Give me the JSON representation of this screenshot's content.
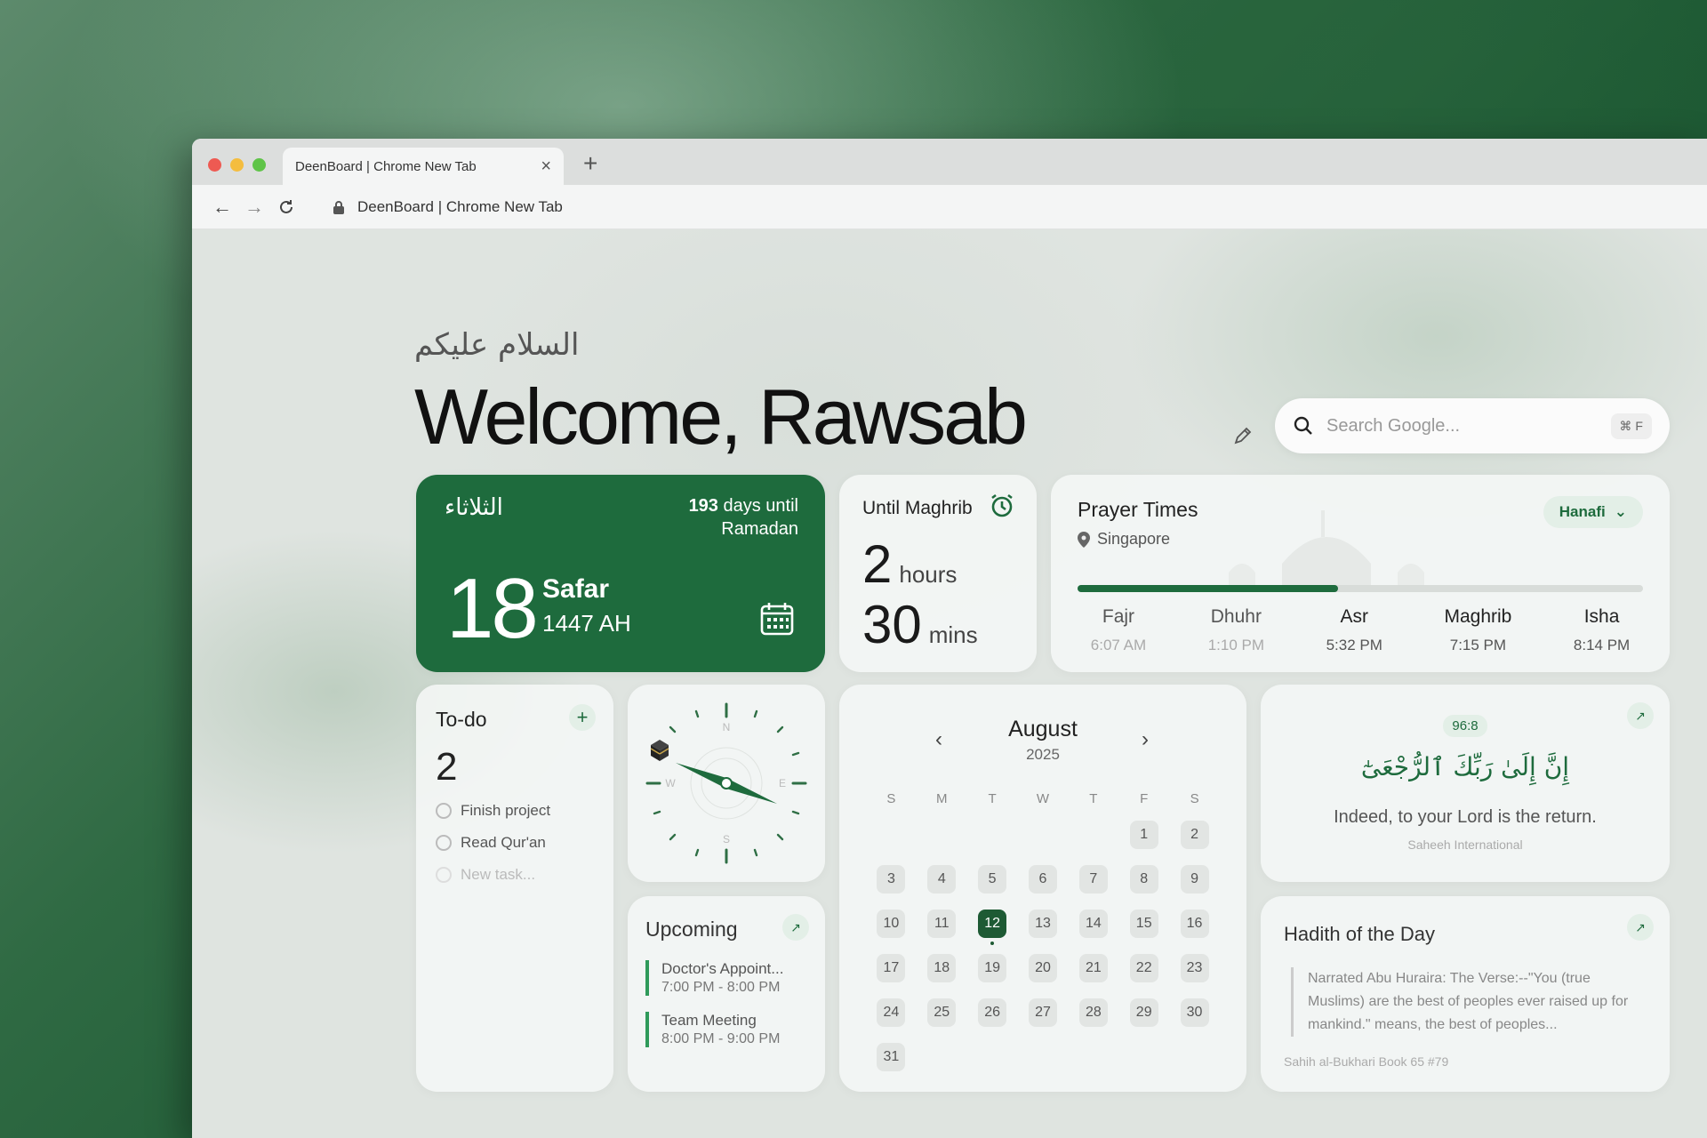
{
  "browser": {
    "tab_title": "DeenBoard | Chrome New Tab",
    "address": "DeenBoard | Chrome New Tab"
  },
  "header": {
    "greeting_arabic": "السلام عليكم",
    "welcome": "Welcome, Rawsab",
    "search_placeholder": "Search Google...",
    "search_shortcut": "⌘ F"
  },
  "date_card": {
    "weekday_arabic": "الثلاثاء",
    "days_count": "193",
    "days_text": "days until",
    "days_target": "Ramadan",
    "day": "18",
    "month": "Safar",
    "year": "1447 AH"
  },
  "countdown": {
    "label_prefix": "Until",
    "label_prayer": "Maghrib",
    "hours": "2",
    "hours_unit": "hours",
    "mins": "30",
    "mins_unit": "mins"
  },
  "prayer_times": {
    "title": "Prayer Times",
    "location": "Singapore",
    "madhab": "Hanafi",
    "progress": 0.46,
    "prayers": [
      {
        "name": "Fajr",
        "time": "6:07 AM"
      },
      {
        "name": "Dhuhr",
        "time": "1:10 PM"
      },
      {
        "name": "Asr",
        "time": "5:32 PM"
      },
      {
        "name": "Maghrib",
        "time": "7:15 PM"
      },
      {
        "name": "Isha",
        "time": "8:14 PM"
      }
    ]
  },
  "todo": {
    "title": "To-do",
    "count": "2",
    "items": [
      "Finish project",
      "Read Qur'an"
    ],
    "new_placeholder": "New task..."
  },
  "compass": {
    "labels": {
      "n": "N",
      "e": "E",
      "s": "S",
      "w": "W"
    }
  },
  "upcoming": {
    "title": "Upcoming",
    "events": [
      {
        "name": "Doctor's Appoint...",
        "time": "7:00 PM - 8:00 PM"
      },
      {
        "name": "Team Meeting",
        "time": "8:00 PM - 9:00 PM"
      }
    ]
  },
  "calendar": {
    "month": "August",
    "year": "2025",
    "weekdays": [
      "S",
      "M",
      "T",
      "W",
      "T",
      "F",
      "S"
    ],
    "leading_blanks": 5,
    "days_in_month": 31,
    "today": 12
  },
  "verse": {
    "reference": "96:8",
    "arabic": "إِنَّ إِلَىٰ رَبِّكَ ٱلرُّجْعَىٰٓ",
    "translation": "Indeed, to your Lord is the return.",
    "source": "Saheeh International"
  },
  "hadith": {
    "title": "Hadith of the Day",
    "text": "Narrated Abu Huraira: The Verse:--\"You (true Muslims) are the best of peoples ever raised up for mankind.\" means, the best of peoples...",
    "source": "Sahih al-Bukhari Book 65 #79"
  },
  "colors": {
    "accent": "#1e6b3d",
    "accent_light": "#e3efe7"
  }
}
